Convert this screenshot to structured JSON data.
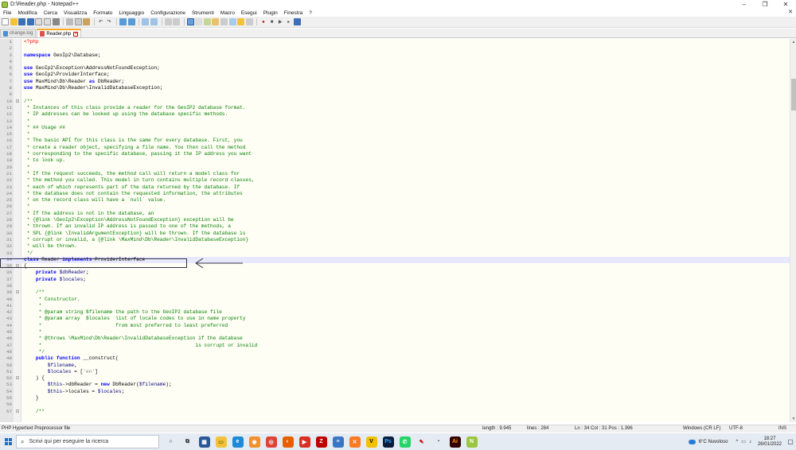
{
  "window": {
    "title": "D:\\Reader.php - Notepad++",
    "controls": [
      "–",
      "❐",
      "✕"
    ]
  },
  "menu": {
    "items": [
      "File",
      "Modifica",
      "Cerca",
      "Visualizza",
      "Formato",
      "Linguaggio",
      "Configurazione",
      "Strumenti",
      "Macro",
      "Esegui",
      "Plugin",
      "Finestra",
      "?"
    ],
    "close_glyph": "✕"
  },
  "tabs": [
    {
      "label": "change.log",
      "active": false,
      "icon": "file-icon"
    },
    {
      "label": "Reader.php",
      "active": true,
      "icon": "php-file-icon"
    }
  ],
  "editor": {
    "current_line": 34,
    "lines": [
      {
        "n": "1",
        "fold": "",
        "segs": [
          [
            "php",
            "<?php"
          ]
        ]
      },
      {
        "n": "2",
        "fold": "",
        "segs": []
      },
      {
        "n": "3",
        "fold": "",
        "segs": [
          [
            "kw",
            "namespace"
          ],
          [
            "txt",
            " GeoIp2\\Database;"
          ]
        ]
      },
      {
        "n": "4",
        "fold": "",
        "segs": []
      },
      {
        "n": "5",
        "fold": "",
        "segs": [
          [
            "kw",
            "use"
          ],
          [
            "txt",
            " GeoIp2\\Exception\\AddressNotFoundException;"
          ]
        ]
      },
      {
        "n": "6",
        "fold": "",
        "segs": [
          [
            "kw",
            "use"
          ],
          [
            "txt",
            " GeoIp2\\ProviderInterface;"
          ]
        ]
      },
      {
        "n": "7",
        "fold": "",
        "segs": [
          [
            "kw",
            "use"
          ],
          [
            "txt",
            " MaxMind\\Db\\Reader "
          ],
          [
            "kw",
            "as"
          ],
          [
            "txt",
            " DbReader;"
          ]
        ]
      },
      {
        "n": "8",
        "fold": "",
        "segs": [
          [
            "kw",
            "use"
          ],
          [
            "txt",
            " MaxMind\\Db\\Reader\\InvalidDatabaseException;"
          ]
        ]
      },
      {
        "n": "9",
        "fold": "",
        "segs": []
      },
      {
        "n": "10",
        "fold": "⊟",
        "segs": [
          [
            "cm",
            "/**"
          ]
        ]
      },
      {
        "n": "11",
        "fold": "",
        "segs": [
          [
            "cm",
            " * Instances of this class provide a reader for the GeoIP2 database format."
          ]
        ]
      },
      {
        "n": "12",
        "fold": "",
        "segs": [
          [
            "cm",
            " * IP addresses can be looked up using the database specific methods."
          ]
        ]
      },
      {
        "n": "13",
        "fold": "",
        "segs": [
          [
            "cm",
            " *"
          ]
        ]
      },
      {
        "n": "14",
        "fold": "",
        "segs": [
          [
            "cm",
            " * ## Usage ##"
          ]
        ]
      },
      {
        "n": "15",
        "fold": "",
        "segs": [
          [
            "cm",
            " *"
          ]
        ]
      },
      {
        "n": "16",
        "fold": "",
        "segs": [
          [
            "cm",
            " * The basic API for this class is the same for every database. First, you"
          ]
        ]
      },
      {
        "n": "17",
        "fold": "",
        "segs": [
          [
            "cm",
            " * create a reader object, specifying a file name. You then call the method"
          ]
        ]
      },
      {
        "n": "18",
        "fold": "",
        "segs": [
          [
            "cm",
            " * corresponding to the specific database, passing it the IP address you want"
          ]
        ]
      },
      {
        "n": "19",
        "fold": "",
        "segs": [
          [
            "cm",
            " * to look up."
          ]
        ]
      },
      {
        "n": "20",
        "fold": "",
        "segs": [
          [
            "cm",
            " *"
          ]
        ]
      },
      {
        "n": "21",
        "fold": "",
        "segs": [
          [
            "cm",
            " * If the request succeeds, the method call will return a model class for"
          ]
        ]
      },
      {
        "n": "22",
        "fold": "",
        "segs": [
          [
            "cm",
            " * the method you called. This model in turn contains multiple record classes,"
          ]
        ]
      },
      {
        "n": "23",
        "fold": "",
        "segs": [
          [
            "cm",
            " * each of which represents part of the data returned by the database. If"
          ]
        ]
      },
      {
        "n": "24",
        "fold": "",
        "segs": [
          [
            "cm",
            " * the database does not contain the requested information, the attributes"
          ]
        ]
      },
      {
        "n": "25",
        "fold": "",
        "segs": [
          [
            "cm",
            " * on the record class will have a `null` value."
          ]
        ]
      },
      {
        "n": "26",
        "fold": "",
        "segs": [
          [
            "cm",
            " *"
          ]
        ]
      },
      {
        "n": "27",
        "fold": "",
        "segs": [
          [
            "cm",
            " * If the address is not in the database, an"
          ]
        ]
      },
      {
        "n": "28",
        "fold": "",
        "segs": [
          [
            "cm",
            " * {@link \\GeoIp2\\Exception\\AddressNotFoundException} exception will be"
          ]
        ]
      },
      {
        "n": "29",
        "fold": "",
        "segs": [
          [
            "cm",
            " * thrown. If an invalid IP address is passed to one of the methods, a"
          ]
        ]
      },
      {
        "n": "30",
        "fold": "",
        "segs": [
          [
            "cm",
            " * SPL {@link \\InvalidArgumentException} will be thrown. If the database is"
          ]
        ]
      },
      {
        "n": "31",
        "fold": "",
        "segs": [
          [
            "cm",
            " * corrupt or invalid, a {@link \\MaxMind\\Db\\Reader\\InvalidDatabaseException}"
          ]
        ]
      },
      {
        "n": "32",
        "fold": "",
        "segs": [
          [
            "cm",
            " * will be thrown."
          ]
        ]
      },
      {
        "n": "33",
        "fold": "",
        "segs": [
          [
            "cm",
            " */"
          ]
        ]
      },
      {
        "n": "34",
        "fold": "",
        "segs": [
          [
            "kw",
            "class"
          ],
          [
            "txt",
            " Reader "
          ],
          [
            "kw",
            "implements"
          ],
          [
            "txt",
            " ProviderInterface"
          ]
        ]
      },
      {
        "n": "35",
        "fold": "⊟",
        "segs": [
          [
            "txt",
            "{"
          ]
        ]
      },
      {
        "n": "36",
        "fold": "",
        "segs": [
          [
            "kw",
            "    private"
          ],
          [
            "var",
            " $dbReader"
          ],
          [
            "txt",
            ";"
          ]
        ]
      },
      {
        "n": "37",
        "fold": "",
        "segs": [
          [
            "kw",
            "    private"
          ],
          [
            "var",
            " $locales"
          ],
          [
            "txt",
            ";"
          ]
        ]
      },
      {
        "n": "38",
        "fold": "",
        "segs": []
      },
      {
        "n": "39",
        "fold": "⊟",
        "segs": [
          [
            "cm",
            "    /**"
          ]
        ]
      },
      {
        "n": "40",
        "fold": "",
        "segs": [
          [
            "cm",
            "     * Constructor."
          ]
        ]
      },
      {
        "n": "41",
        "fold": "",
        "segs": [
          [
            "cm",
            "     *"
          ]
        ]
      },
      {
        "n": "42",
        "fold": "",
        "segs": [
          [
            "cm",
            "     * @param string $filename the path to the GeoIP2 database file"
          ]
        ]
      },
      {
        "n": "43",
        "fold": "",
        "segs": [
          [
            "cm",
            "     * @param array  $locales  list of locale codes to use in name property"
          ]
        ]
      },
      {
        "n": "44",
        "fold": "",
        "segs": [
          [
            "cm",
            "     *                         from most preferred to least preferred"
          ]
        ]
      },
      {
        "n": "45",
        "fold": "",
        "segs": [
          [
            "cm",
            "     *"
          ]
        ]
      },
      {
        "n": "46",
        "fold": "",
        "segs": [
          [
            "cm",
            "     * @throws \\MaxMind\\Db\\Reader\\InvalidDatabaseException if the database"
          ]
        ]
      },
      {
        "n": "47",
        "fold": "",
        "segs": [
          [
            "cm",
            "     *                                                    is corrupt or invalid"
          ]
        ]
      },
      {
        "n": "48",
        "fold": "",
        "segs": [
          [
            "cm",
            "     */"
          ]
        ]
      },
      {
        "n": "49",
        "fold": "",
        "segs": [
          [
            "kw",
            "    public function"
          ],
          [
            "txt",
            " __construct("
          ]
        ]
      },
      {
        "n": "50",
        "fold": "",
        "segs": [
          [
            "var",
            "        $filename"
          ],
          [
            "txt",
            ","
          ]
        ]
      },
      {
        "n": "51",
        "fold": "",
        "segs": [
          [
            "var",
            "        $locales"
          ],
          [
            "txt",
            " = ["
          ],
          [
            "str",
            "'en'"
          ],
          [
            "txt",
            "]"
          ]
        ]
      },
      {
        "n": "52",
        "fold": "⊟",
        "segs": [
          [
            "txt",
            "    ) {"
          ]
        ]
      },
      {
        "n": "53",
        "fold": "",
        "segs": [
          [
            "var",
            "        $this"
          ],
          [
            "txt",
            "->dbReader = "
          ],
          [
            "kw",
            "new"
          ],
          [
            "txt",
            " DbReader("
          ],
          [
            "var",
            "$filename"
          ],
          [
            "txt",
            ");"
          ]
        ]
      },
      {
        "n": "54",
        "fold": "",
        "segs": [
          [
            "var",
            "        $this"
          ],
          [
            "txt",
            "->locales = "
          ],
          [
            "var",
            "$locales"
          ],
          [
            "txt",
            ";"
          ]
        ]
      },
      {
        "n": "55",
        "fold": "",
        "segs": [
          [
            "txt",
            "    }"
          ]
        ]
      },
      {
        "n": "56",
        "fold": "",
        "segs": []
      },
      {
        "n": "57",
        "fold": "⊟",
        "segs": [
          [
            "cm",
            "    /**"
          ]
        ]
      }
    ]
  },
  "status": {
    "file_type": "PHP Hypertext Preprocessor file",
    "length": "length : 9.945",
    "lines": "lines : 284",
    "position": "Ln : 34    Col : 31    Pos : 1.396",
    "eol": "Windows (CR LF)",
    "encoding": "UTF-8",
    "mode": "INS"
  },
  "taskbar": {
    "search_placeholder": "Scrivi qui per eseguire la ricerca",
    "apps": [
      {
        "name": "cortana-icon",
        "glyph": "○",
        "color": "#e5ebf2",
        "fg": "#222"
      },
      {
        "name": "task-view-icon",
        "glyph": "⧉",
        "color": "#e5ebf2",
        "fg": "#222"
      },
      {
        "name": "store-icon",
        "glyph": "▦",
        "color": "#2b5797",
        "fg": "#fff"
      },
      {
        "name": "file-explorer-icon",
        "glyph": "▭",
        "color": "#f2c33a",
        "fg": "#7a5c00"
      },
      {
        "name": "edge-icon",
        "glyph": "e",
        "color": "#1c8ad6",
        "fg": "#fff"
      },
      {
        "name": "firefox-alt-icon",
        "glyph": "◉",
        "color": "#f0902e",
        "fg": "#fff"
      },
      {
        "name": "chrome-icon",
        "glyph": "◎",
        "color": "#db4437",
        "fg": "#fff"
      },
      {
        "name": "firefox-icon",
        "glyph": "◐",
        "color": "#e66000",
        "fg": "#fff"
      },
      {
        "name": "video-icon",
        "glyph": "▶",
        "color": "#d93025",
        "fg": "#fff"
      },
      {
        "name": "filezilla-icon",
        "glyph": "Z",
        "color": "#bf0000",
        "fg": "#fff"
      },
      {
        "name": "notepad-icon",
        "glyph": "≡",
        "color": "#3a76c4",
        "fg": "#fff"
      },
      {
        "name": "xampp-icon",
        "glyph": "✕",
        "color": "#fb7a24",
        "fg": "#fff"
      },
      {
        "name": "vectorworks-icon",
        "glyph": "V",
        "color": "#f2c200",
        "fg": "#000"
      },
      {
        "name": "photoshop-icon",
        "glyph": "Ps",
        "color": "#0b1d3a",
        "fg": "#31a8ff"
      },
      {
        "name": "whatsapp-icon",
        "glyph": "✆",
        "color": "#25d366",
        "fg": "#fff"
      },
      {
        "name": "paint-icon",
        "glyph": "✎",
        "color": "#e5ebf2",
        "fg": "#c00"
      },
      {
        "name": "speedometer-icon",
        "glyph": "◔",
        "color": "#e5ebf2",
        "fg": "#222"
      },
      {
        "name": "illustrator-icon",
        "glyph": "Ai",
        "color": "#330000",
        "fg": "#ff9a00"
      },
      {
        "name": "notepadpp-icon",
        "glyph": "N",
        "color": "#9bc53d",
        "fg": "#fff"
      }
    ],
    "weather": "6°C  Nuvoloso",
    "tray_icons": [
      "^",
      "▭",
      "♪"
    ],
    "time": "18:27",
    "date": "26/01/2022",
    "notification_glyph": "▢"
  }
}
